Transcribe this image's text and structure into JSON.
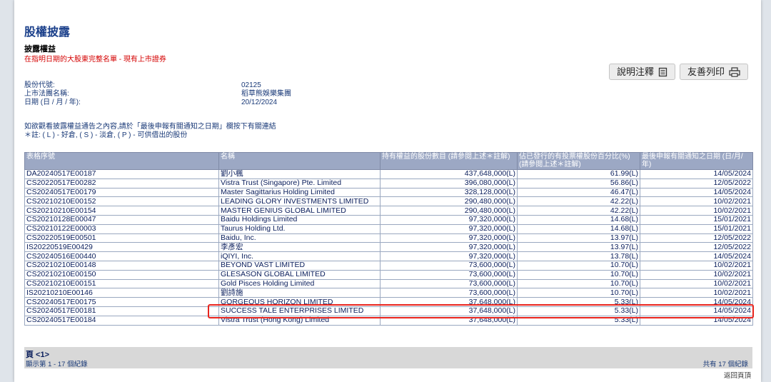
{
  "header": {
    "title": "股權披露",
    "subtitle": "披露權益",
    "subnote": "在指明日期的大股東完整名單 - 現有上市證券"
  },
  "buttons": {
    "notes_label": "說明注釋",
    "print_label": "友善列印"
  },
  "info": [
    {
      "label": "股份代號:",
      "value": "02125"
    },
    {
      "label": "上市法團名稱:",
      "value": "稻草熊娛樂集團"
    },
    {
      "label": "日期 (日 / 月 / 年):",
      "value": "20/12/2024"
    }
  ],
  "notes": {
    "line1": "如欲觀看披露權益通告之內容,請於「最後申報有關通知之日期」欄按下有關連結",
    "line2": "＊註: ( L ) - 好倉, ( S ) - 淡倉, ( P ) - 可供借出的股份"
  },
  "table": {
    "headers": [
      "表格序號",
      "名稱",
      "持有權益的股份數目 (請參閱上述＊註解)",
      "佔已發行的有投票權股份百分比(%) (請參閱上述＊註解)",
      "最後申報有關通知之日期 (日/月/年)"
    ],
    "rows": [
      {
        "form": "DA20240517E00187",
        "name": "劉小楓",
        "shares": "437,648,000(L)",
        "pct": "61.99(L)",
        "date": "14/05/2024"
      },
      {
        "form": "CS20220517E00282",
        "name": "Vistra Trust (Singapore) Pte. Limited",
        "shares": "396,080,000(L)",
        "pct": "56.86(L)",
        "date": "12/05/2022"
      },
      {
        "form": "CS20240517E00179",
        "name": "Master Sagittarius Holding Limited",
        "shares": "328,128,000(L)",
        "pct": "46.47(L)",
        "date": "14/05/2024"
      },
      {
        "form": "CS20210210E00152",
        "name": "LEADING GLORY INVESTMENTS LIMITED",
        "shares": "290,480,000(L)",
        "pct": "42.22(L)",
        "date": "10/02/2021"
      },
      {
        "form": "CS20210210E00154",
        "name": "MASTER GENIUS GLOBAL LIMITED",
        "shares": "290,480,000(L)",
        "pct": "42.22(L)",
        "date": "10/02/2021"
      },
      {
        "form": "CS20210128E00047",
        "name": "Baidu Holdings Limited",
        "shares": "97,320,000(L)",
        "pct": "14.68(L)",
        "date": "15/01/2021"
      },
      {
        "form": "CS20210122E00003",
        "name": "Taurus Holding Ltd.",
        "shares": "97,320,000(L)",
        "pct": "14.68(L)",
        "date": "15/01/2021"
      },
      {
        "form": "CS20220519E00501",
        "name": "Baidu, Inc.",
        "shares": "97,320,000(L)",
        "pct": "13.97(L)",
        "date": "12/05/2022"
      },
      {
        "form": "IS20220519E00429",
        "name": "李彥宏",
        "shares": "97,320,000(L)",
        "pct": "13.97(L)",
        "date": "12/05/2022"
      },
      {
        "form": "CS20240516E00440",
        "name": "iQIYI, Inc.",
        "shares": "97,320,000(L)",
        "pct": "13.78(L)",
        "date": "14/05/2024"
      },
      {
        "form": "CS20210210E00148",
        "name": "BEYOND VAST LIMITED",
        "shares": "73,600,000(L)",
        "pct": "10.70(L)",
        "date": "10/02/2021"
      },
      {
        "form": "CS20210210E00150",
        "name": "GLESASON GLOBAL LIMITED",
        "shares": "73,600,000(L)",
        "pct": "10.70(L)",
        "date": "10/02/2021"
      },
      {
        "form": "CS20210210E00151",
        "name": "Gold Pisces Holding Limited",
        "shares": "73,600,000(L)",
        "pct": "10.70(L)",
        "date": "10/02/2021"
      },
      {
        "form": "IS20210210E00146",
        "name": "劉詩施",
        "shares": "73,600,000(L)",
        "pct": "10.70(L)",
        "date": "10/02/2021"
      },
      {
        "form": "CS20240517E00175",
        "name": "GORGEOUS HORIZON LIMITED",
        "shares": "37,648,000(L)",
        "pct": "5.33(L)",
        "date": "14/05/2024"
      },
      {
        "form": "CS20240517E00181",
        "name": "SUCCESS TALE ENTERPRISES LIMITED",
        "shares": "37,648,000(L)",
        "pct": "5.33(L)",
        "date": "14/05/2024"
      },
      {
        "form": "CS20240517E00184",
        "name": "Vistra Trust (Hong Kong) Limited",
        "shares": "37,648,000(L)",
        "pct": "5.33(L)",
        "date": "14/05/2024"
      }
    ]
  },
  "footer": {
    "pager": "頁 <1>",
    "showing": "顯示第 1 - 17 個紀錄",
    "total": "共有 17 個紀錄",
    "back_to_top": "返回頁頂"
  },
  "colors": {
    "title": "#1a3f8a",
    "header_bg": "#9ca8c4",
    "highlight_box": "#e8241d",
    "subnote": "#d40000"
  }
}
